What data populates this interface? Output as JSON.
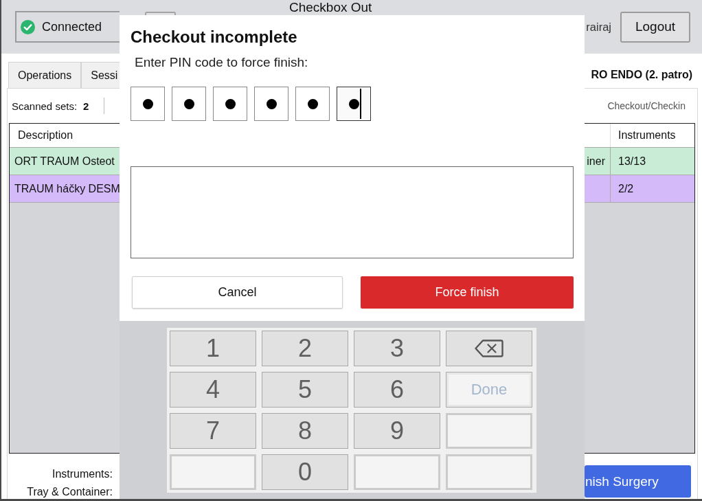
{
  "header": {
    "connection": {
      "label": "Connected",
      "connected": true
    },
    "title": "Checkbox Out",
    "user": "rairaj",
    "logout_button": "Logout"
  },
  "tabs": [
    {
      "label": "Operations",
      "selected": false
    },
    {
      "label": "Sessi",
      "selected": false
    }
  ],
  "location": "RO ENDO (2. patro)",
  "scanned_sets": {
    "label": "Scanned sets:",
    "value": "2"
  },
  "mode_link": "Checkout/Checkin",
  "table": {
    "columns": {
      "description": "Description",
      "instruments": "Instruments"
    },
    "rows": [
      {
        "color": "#c8ecd6",
        "description": "ORT TRAUM Osteot",
        "column_2": "iner",
        "instruments": "13/13"
      },
      {
        "color": "#d4baf8",
        "description": "TRAUM háčky DESM",
        "instruments": "2/2"
      }
    ]
  },
  "summary": {
    "labels": [
      "Instruments:",
      "Tray & Container:"
    ],
    "finish_button": "nish Surgery"
  },
  "dialog": {
    "title": "Checkout incomplete",
    "prompt": "Enter PIN code to force finish:",
    "pin": [
      {
        "filled": true,
        "focused": false
      },
      {
        "filled": true,
        "focused": false
      },
      {
        "filled": true,
        "focused": false
      },
      {
        "filled": true,
        "focused": false
      },
      {
        "filled": true,
        "focused": false
      },
      {
        "filled": true,
        "focused": true
      }
    ],
    "buttons": [
      {
        "kind": "secondary",
        "label": "Cancel"
      },
      {
        "kind": "danger",
        "label": "Force finish"
      }
    ]
  },
  "keypad": {
    "keys": [
      {
        "kind": "digit",
        "label": "1"
      },
      {
        "kind": "digit",
        "label": "2"
      },
      {
        "kind": "digit",
        "label": "3"
      },
      {
        "kind": "backspace"
      },
      {
        "kind": "digit",
        "label": "4"
      },
      {
        "kind": "digit",
        "label": "5"
      },
      {
        "kind": "digit",
        "label": "6"
      },
      {
        "kind": "done",
        "label": "Done",
        "disabled": true
      },
      {
        "kind": "digit",
        "label": "7"
      },
      {
        "kind": "digit",
        "label": "8"
      },
      {
        "kind": "digit",
        "label": "9"
      },
      {
        "kind": "blank"
      },
      {
        "kind": "blank"
      },
      {
        "kind": "digit",
        "label": "0"
      },
      {
        "kind": "blank"
      },
      {
        "kind": "blank"
      }
    ]
  }
}
